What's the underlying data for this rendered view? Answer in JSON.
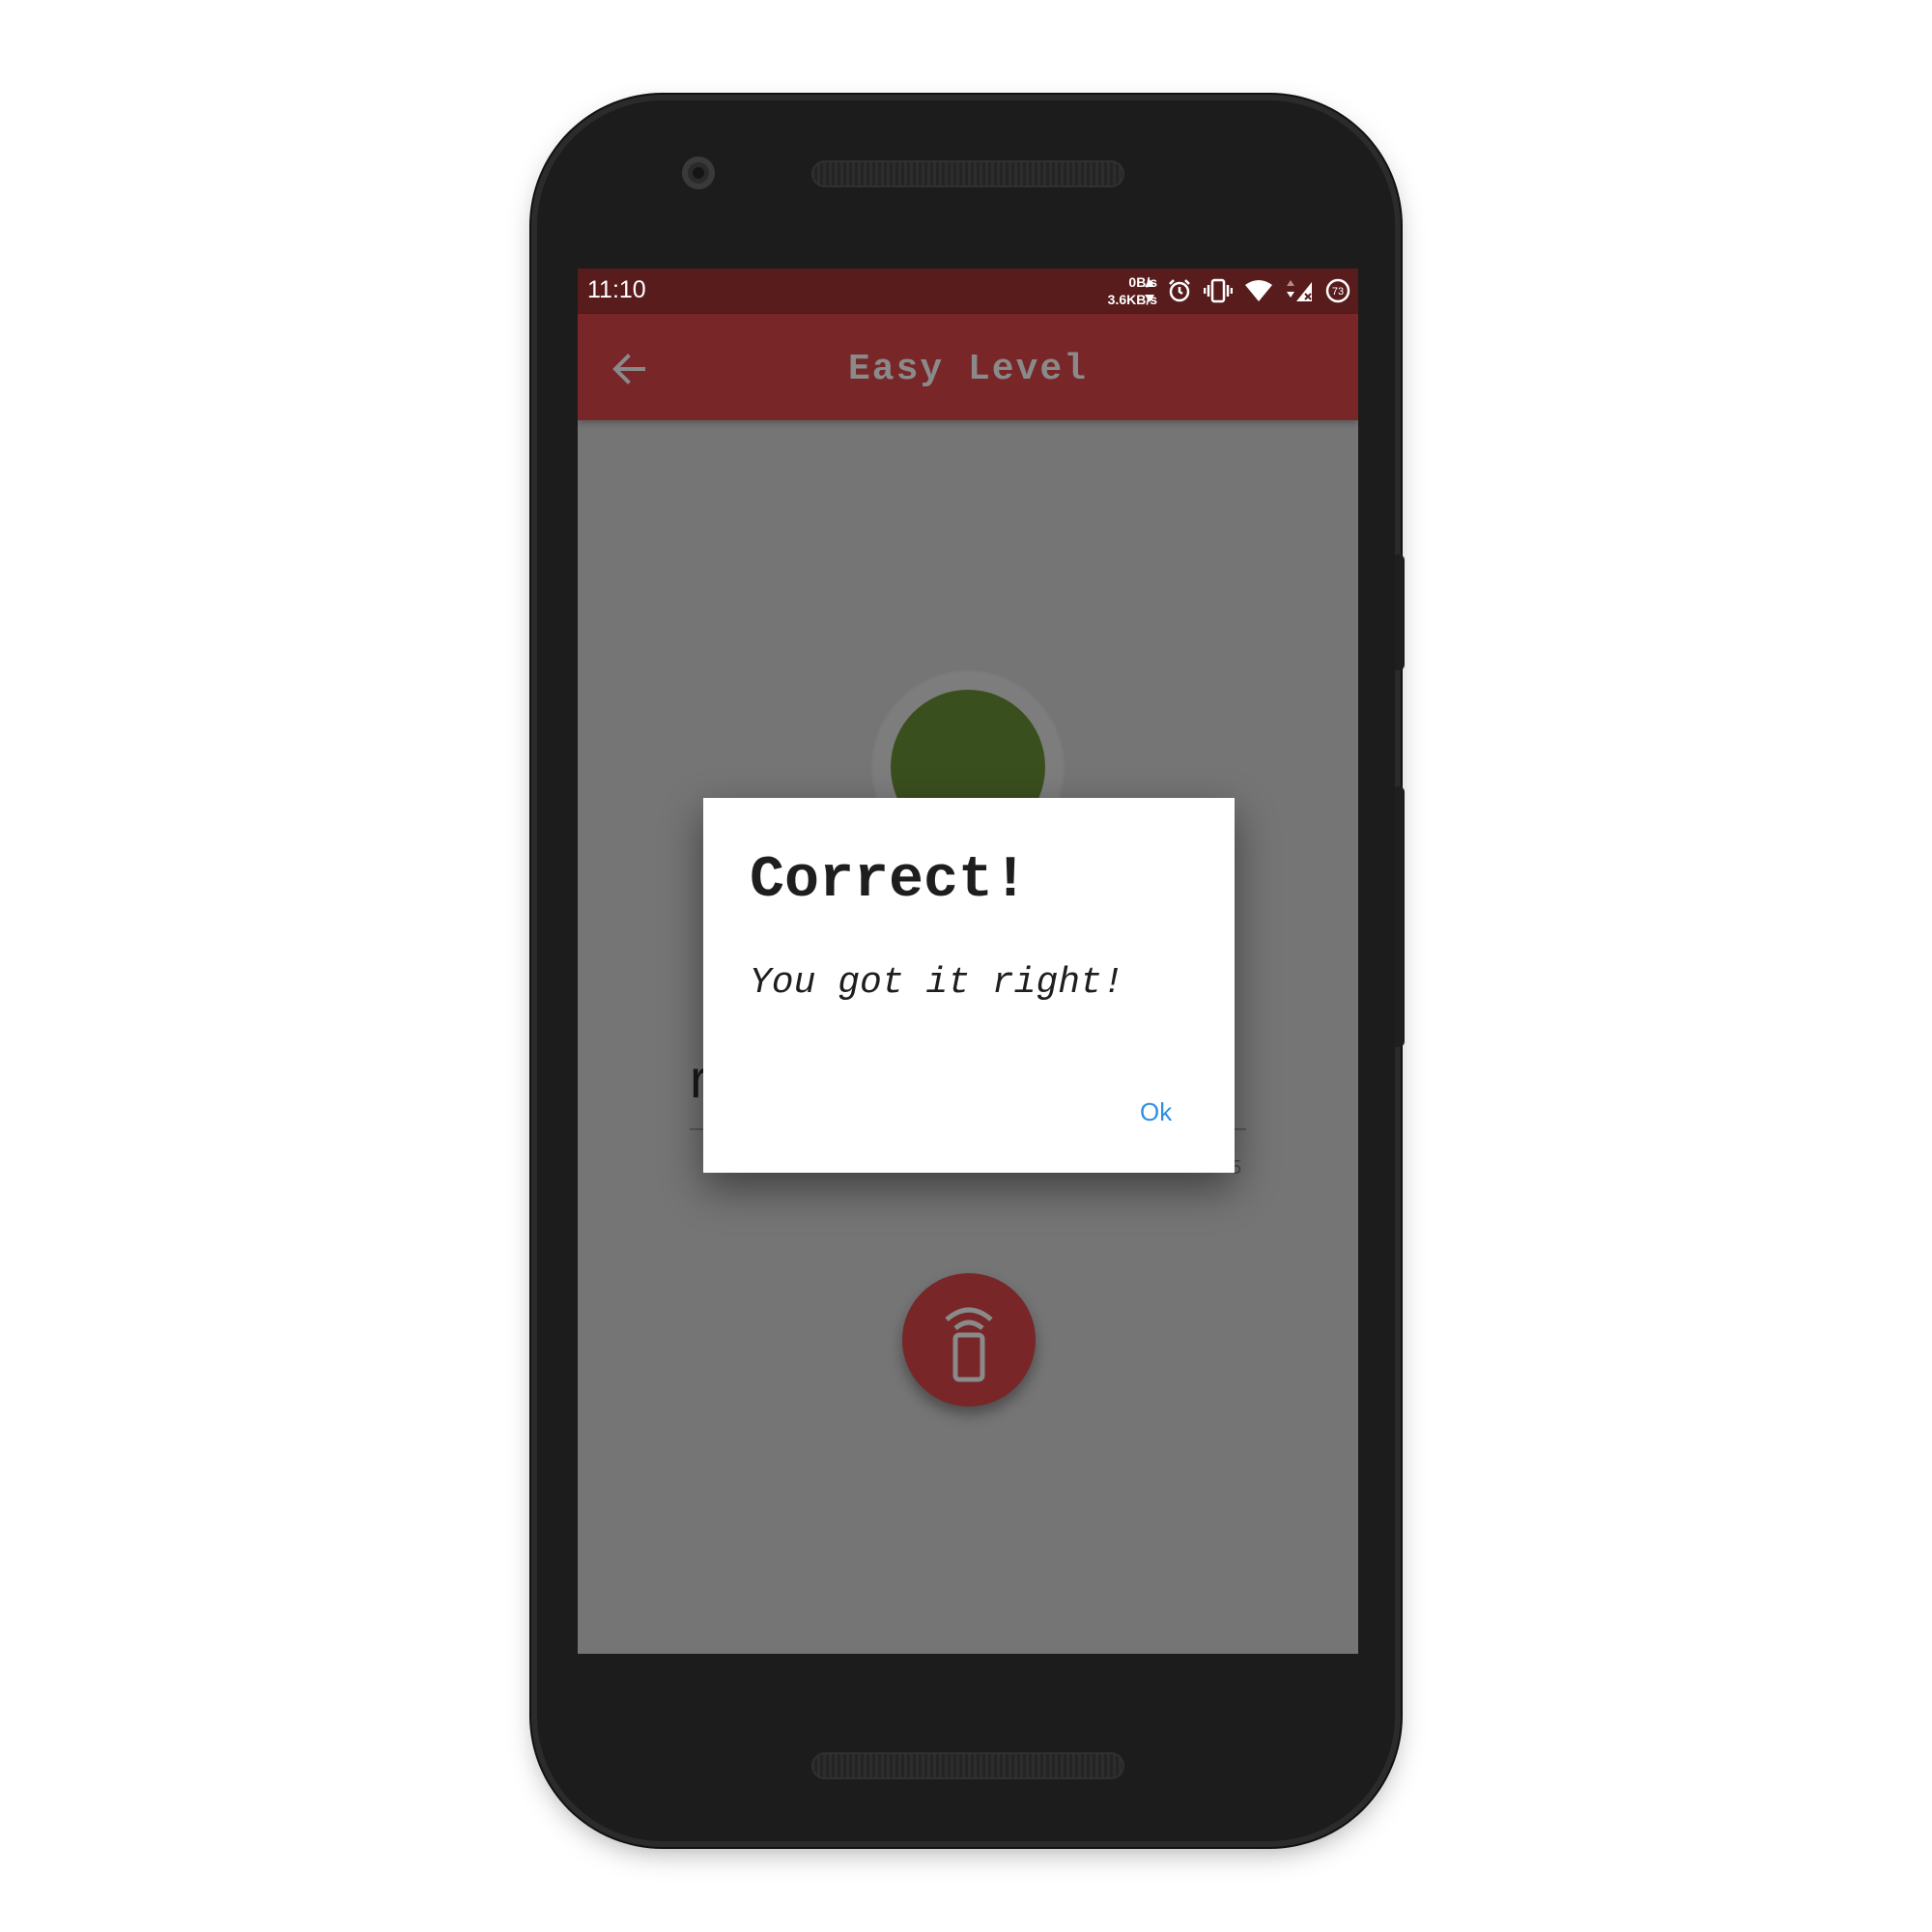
{
  "status_bar": {
    "time": "11:10",
    "upload_speed": "0B/s",
    "download_speed": "3.6KB/s",
    "battery": "73"
  },
  "app_bar": {
    "title": "Easy Level"
  },
  "background": {
    "input_char": "r",
    "counter_char": "5"
  },
  "dialog": {
    "title": "Correct!",
    "message": "You got it right!",
    "ok_label": "Ok"
  },
  "colors": {
    "status_bar": "#591c1c",
    "app_bar": "#782628",
    "indicator": "#3a4f1e",
    "dialog_button": "#2f8fe0"
  }
}
